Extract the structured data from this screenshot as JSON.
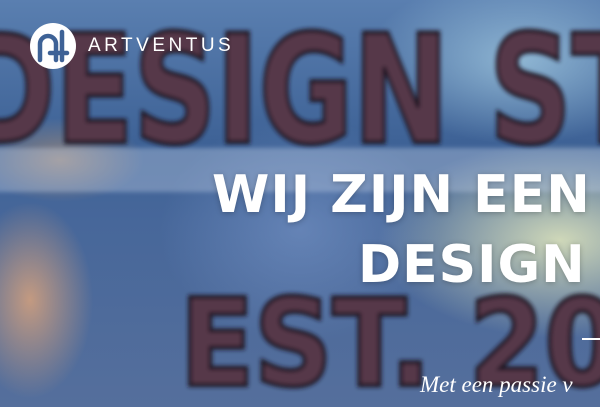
{
  "brand": {
    "logo_icon": "artventus-logo-mark",
    "name": "ARTVENTUS"
  },
  "hero": {
    "background_sign": {
      "row1": "DESIGN ST",
      "row2": "EST. 20"
    },
    "headline_line1": "WIJ ZIJN EEN",
    "headline_line2": "DESIGN",
    "tagline": "Met een passie v"
  },
  "colors": {
    "text": "#ffffff",
    "sign_letters": "#56384a",
    "sky_blue": "#3e6296"
  }
}
